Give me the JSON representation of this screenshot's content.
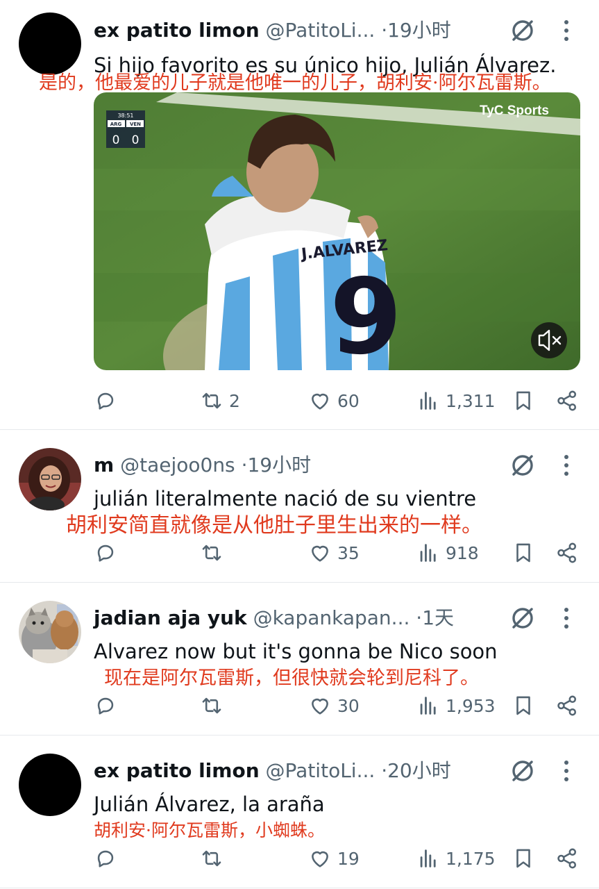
{
  "colors": {
    "accent_translation": "#e03a1e",
    "muted": "#536471",
    "text": "#0f1419"
  },
  "tweets": [
    {
      "name": "ex patito limon",
      "handle": "@PatitoLi...",
      "time": "19小时",
      "text": "Si hijo favorito es su único hijo, Julián Álvarez.",
      "translation": "是的，他最爱的儿子就是他唯一的儿子，胡利安·阿尔瓦雷斯。",
      "avatar": "black-circle",
      "stats": {
        "reply": "",
        "retweet": "2",
        "like": "60",
        "views": "1,311"
      }
    },
    {
      "name": "m",
      "handle": "@taejoo0ns",
      "time": "19小时",
      "text": "julián literalmente nació de su vientre",
      "translation": "胡利安简直就像是从他肚子里生出来的一样。",
      "avatar": "photo-woman",
      "stats": {
        "reply": "",
        "retweet": "",
        "like": "35",
        "views": "918"
      }
    },
    {
      "name": "jadian aja yuk",
      "handle": "@kapankapan...",
      "time": "1天",
      "text": "Alvarez now but it's gonna be Nico soon",
      "translation": "现在是阿尔瓦雷斯，但很快就会轮到尼科了。",
      "avatar": "photo-cats",
      "stats": {
        "reply": "",
        "retweet": "",
        "like": "30",
        "views": "1,953"
      }
    },
    {
      "name": "ex patito limon",
      "handle": "@PatitoLi...",
      "time": "20小时",
      "text": "Julián Álvarez, la araña",
      "translation": "胡利安·阿尔瓦雷斯，小蜘蛛。",
      "avatar": "black-circle",
      "stats": {
        "reply": "",
        "retweet": "",
        "like": "19",
        "views": "1,175"
      }
    }
  ],
  "media": {
    "broadcaster": "TyC Sports",
    "clock": "38:51",
    "team_home": "ARG",
    "team_away": "VEN",
    "score_home": "0",
    "score_away": "0",
    "jersey_name": "J.ALVAREZ",
    "jersey_number": "9",
    "mute_icon": "speaker-muted-icon"
  }
}
